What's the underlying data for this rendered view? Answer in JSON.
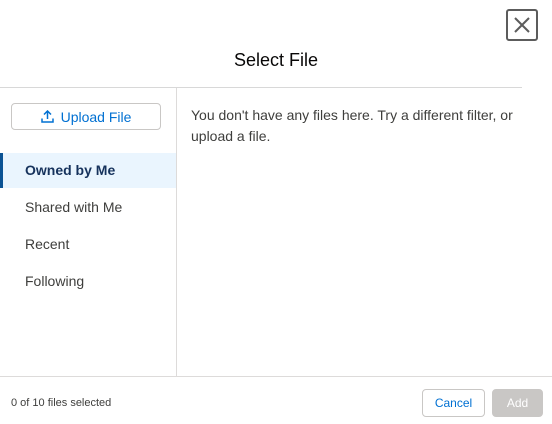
{
  "dialog": {
    "title": "Select File",
    "close_icon": "close-icon"
  },
  "sidebar": {
    "upload_label": "Upload File",
    "upload_icon": "upload-icon",
    "items": [
      {
        "label": "Owned by Me",
        "active": true
      },
      {
        "label": "Shared with Me",
        "active": false
      },
      {
        "label": "Recent",
        "active": false
      },
      {
        "label": "Following",
        "active": false
      }
    ]
  },
  "content": {
    "empty_message": "You don't have any files here. Try a different filter, or upload a file."
  },
  "footer": {
    "status": "0 of 10 files selected",
    "cancel_label": "Cancel",
    "add_label": "Add"
  },
  "colors": {
    "accent": "#0070d2",
    "active_bg": "#eaf5fe",
    "active_border": "#0b5394",
    "disabled_button": "#c9c7c5"
  }
}
